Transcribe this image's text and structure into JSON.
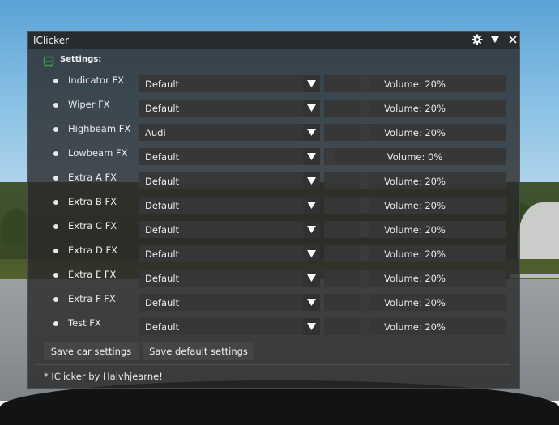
{
  "window": {
    "title": "IClicker"
  },
  "settings": {
    "header": "Settings:",
    "volume_prefix": "Volume: ",
    "rows": [
      {
        "label": "Indicator FX",
        "sound": "Default",
        "volume": 20
      },
      {
        "label": "Wiper FX",
        "sound": "Default",
        "volume": 20
      },
      {
        "label": "Highbeam FX",
        "sound": "Audi",
        "volume": 20
      },
      {
        "label": "Lowbeam FX",
        "sound": "Default",
        "volume": 0
      },
      {
        "label": "Extra A FX",
        "sound": "Default",
        "volume": 20
      },
      {
        "label": "Extra B FX",
        "sound": "Default",
        "volume": 20
      },
      {
        "label": "Extra C FX",
        "sound": "Default",
        "volume": 20
      },
      {
        "label": "Extra D FX",
        "sound": "Default",
        "volume": 20
      },
      {
        "label": "Extra E FX",
        "sound": "Default",
        "volume": 20
      },
      {
        "label": "Extra F FX",
        "sound": "Default",
        "volume": 20
      },
      {
        "label": "Test FX",
        "sound": "Default",
        "volume": 20
      }
    ]
  },
  "buttons": {
    "save_car": "Save car settings",
    "save_default": "Save default settings"
  },
  "footer": "* IClicker by Halvhjearne!",
  "icons": {
    "settings_header": "bus-icon",
    "gear": "gear-icon",
    "collapse": "triangle-down-icon",
    "close": "close-icon",
    "dropdown": "triangle-down-icon"
  },
  "colors": {
    "window_bg": "#282828",
    "widget_bg": "#373737",
    "header_icon": "#3c9a3c"
  }
}
